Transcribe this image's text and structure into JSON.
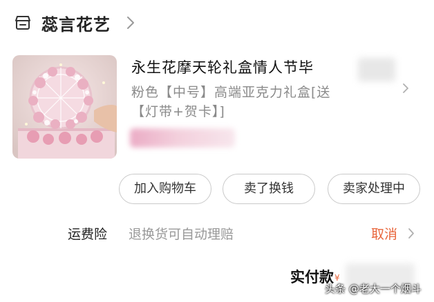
{
  "shop": {
    "name": "蕊言花艺",
    "icon": "shop-icon",
    "chevron": "chevron-right-icon"
  },
  "product": {
    "title": "永生花摩天轮礼盒情人节毕",
    "spec": "粉色【中号】高端亚克力礼盒[送【灯带+贺卡】]",
    "image": "ferris-wheel-flower-gift-box"
  },
  "actions": {
    "add_to_cart": "加入购物车",
    "resell": "卖了换钱",
    "seller_processing": "卖家处理中"
  },
  "shipping_insurance": {
    "label": "运费险",
    "description": "退换货可自动理赔",
    "cancel": "取消"
  },
  "payment": {
    "label": "实付款",
    "currency": "¥"
  },
  "watermark": "头条 @老大一个烟斗",
  "colors": {
    "accent": "#e8653b",
    "muted_text": "#999999",
    "border": "#c9c9c9"
  }
}
